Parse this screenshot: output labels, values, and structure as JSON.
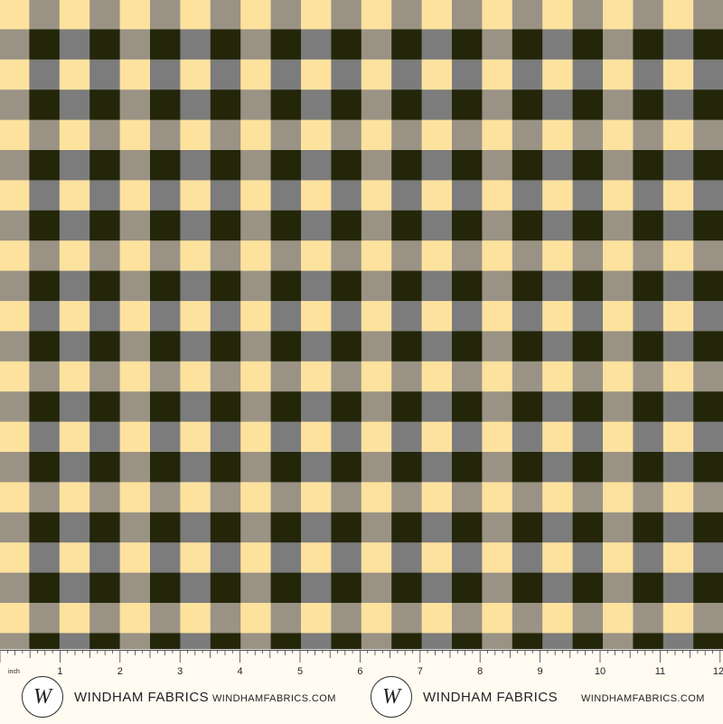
{
  "pattern": {
    "type": "gingham-check",
    "colors": {
      "ground": "#fde29e",
      "warm_gray": "#9a9385",
      "cool_gray": "#7c7c7c",
      "black": "#24260a"
    }
  },
  "ruler": {
    "unit_label": "inch",
    "numbers": [
      "1",
      "2",
      "3",
      "4",
      "5",
      "6",
      "7",
      "8",
      "9",
      "10",
      "11",
      "12"
    ]
  },
  "branding": {
    "logo_letter": "W",
    "name": "WINDHAM FABRICS",
    "url": "WINDHAMFABRICS.COM"
  }
}
